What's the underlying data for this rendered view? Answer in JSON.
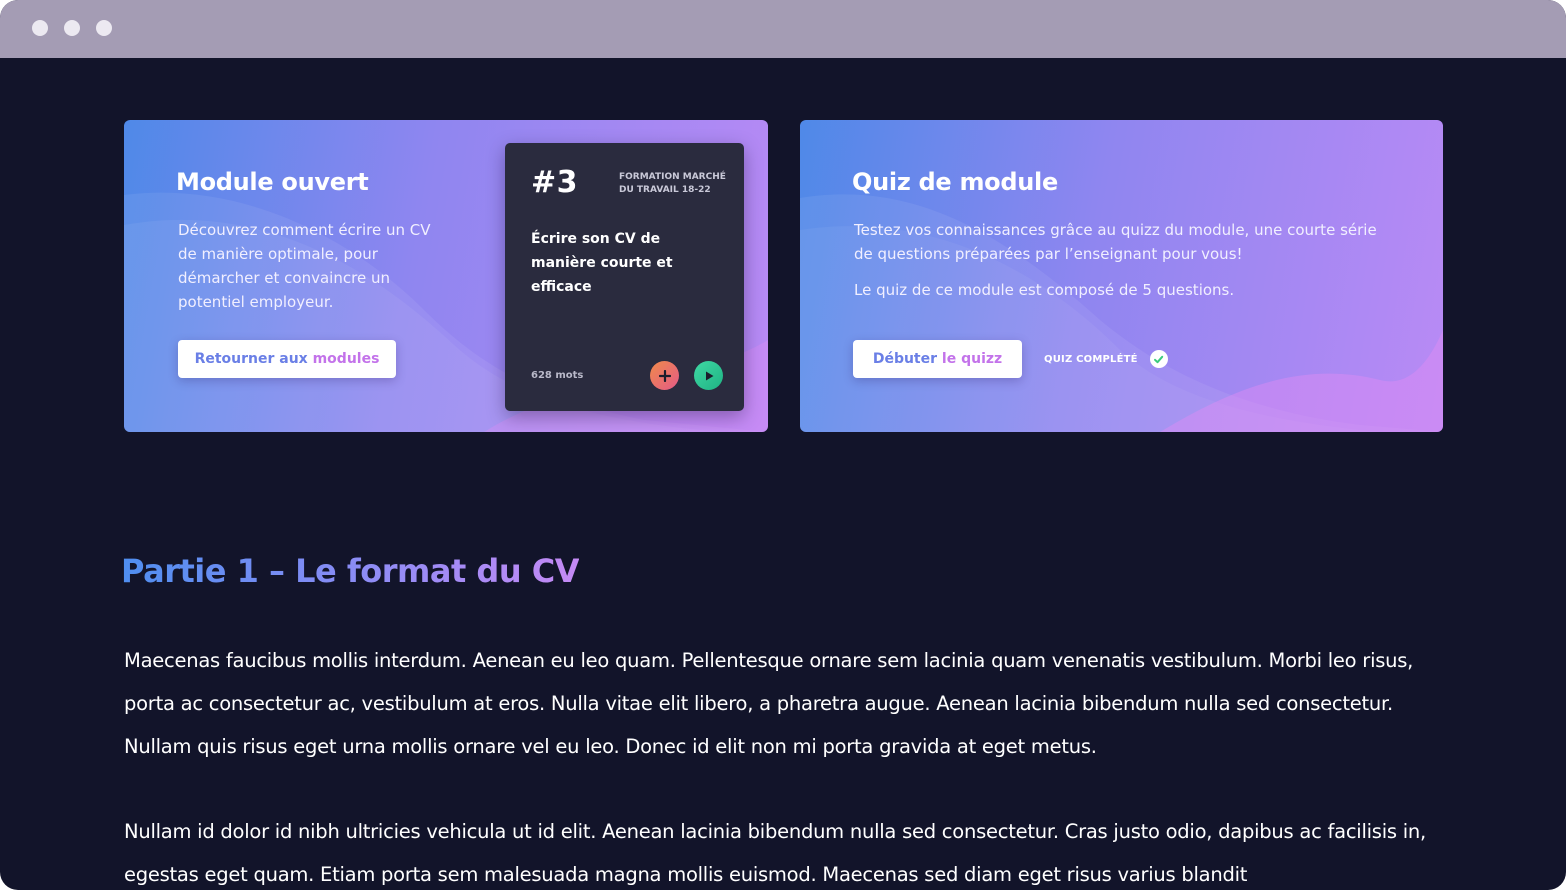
{
  "window": {
    "controls": [
      "close",
      "minimize",
      "maximize"
    ]
  },
  "module_card": {
    "title": "Module ouvert",
    "description": "Découvrez comment écrire un CV de manière optimale, pour démarcher et convaincre un potentiel employeur.",
    "button_part1": "Retourner aux",
    "button_part2": "modules",
    "module": {
      "number": "#3",
      "course": "FORMATION MARCHÉ DU TRAVAIL 18-22",
      "title": "Écrire son CV de manière courte et efficace",
      "words": "628 mots",
      "add_icon": "plus-icon",
      "play_icon": "play-icon"
    }
  },
  "quiz_card": {
    "title": "Quiz de module",
    "description": "Testez vos connaissances grâce au quizz du module, une courte série de questions préparées par l’enseignant pour vous!",
    "description2": "Le quiz de ce module est composé de 5 questions.",
    "button_part1": "Débuter",
    "button_part2": "le quizz",
    "status_label": "QUIZ COMPLÉTÉ",
    "status_icon": "check-icon"
  },
  "content": {
    "section_title": "Partie 1 – Le format du CV",
    "paragraph1": "Maecenas faucibus mollis interdum. Aenean eu leo quam. Pellentesque ornare sem lacinia quam venenatis vestibulum. Morbi leo risus, porta ac consectetur ac, vestibulum at eros. Nulla vitae elit libero, a pharetra augue. Aenean lacinia bibendum nulla sed consectetur. Nullam quis risus eget urna mollis ornare vel eu leo. Donec id elit non mi porta gravida at eget metus.",
    "paragraph2": "Nullam id dolor id nibh ultricies vehicula ut id elit. Aenean lacinia bibendum nulla sed consectetur. Cras justo odio, dapibus ac facilisis in, egestas eget quam. Etiam porta sem malesuada magna mollis euismod. Maecenas sed diam eget risus varius blandit"
  },
  "colors": {
    "background": "#12142a",
    "titlebar": "#a49cb4",
    "gradient_start": "#4f89e8",
    "gradient_end": "#b98af5",
    "module_card": "#2a2b3e",
    "accent_orange": "#f08a4a",
    "accent_green": "#3fd8a4"
  }
}
